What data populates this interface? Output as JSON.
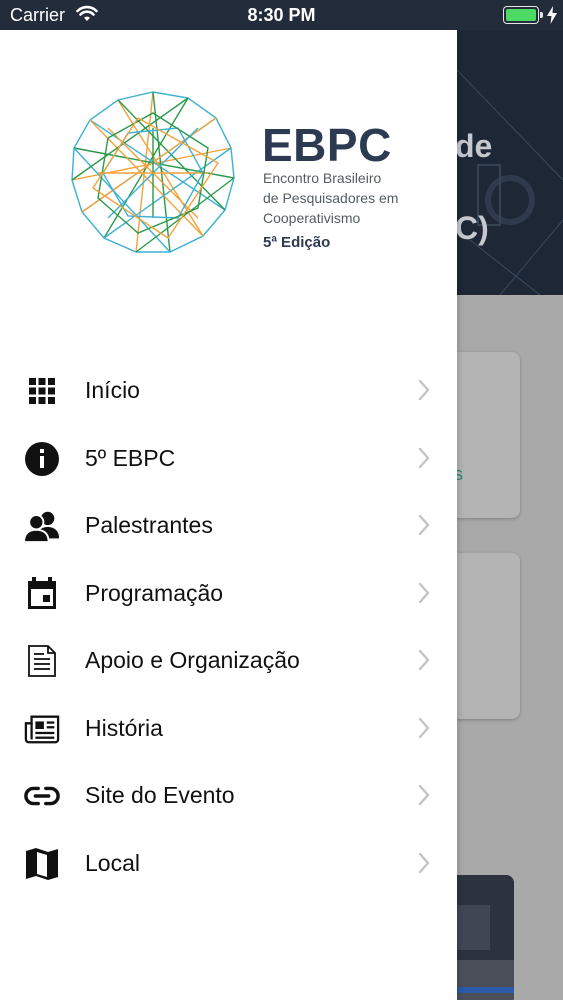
{
  "status_bar": {
    "carrier": "Carrier",
    "time": "8:30 PM",
    "battery_level": 1.0,
    "battery_color": "#4cd964"
  },
  "background_screen": {
    "title_line_1": "de",
    "title_line_2": "C)",
    "card_text": "s"
  },
  "drawer": {
    "logo": {
      "acronym": "EBPC",
      "subtitle_line_1": "Encontro Brasileiro",
      "subtitle_line_2": "de Pesquisadores em",
      "subtitle_line_3": "Cooperativismo",
      "edition": "5ª Edição"
    },
    "menu": [
      {
        "label": "Início",
        "icon": "grid-icon"
      },
      {
        "label": "5º EBPC",
        "icon": "info-icon"
      },
      {
        "label": "Palestrantes",
        "icon": "people-icon"
      },
      {
        "label": "Programação",
        "icon": "calendar-icon"
      },
      {
        "label": "Apoio e Organização",
        "icon": "document-icon"
      },
      {
        "label": "História",
        "icon": "newspaper-icon"
      },
      {
        "label": "Site do Evento",
        "icon": "link-icon"
      },
      {
        "label": "Local",
        "icon": "map-icon"
      }
    ]
  },
  "colors": {
    "brand_navy": "#2c3a52",
    "header_dark": "#1e2735",
    "accent_teal": "#2b8a7a"
  }
}
